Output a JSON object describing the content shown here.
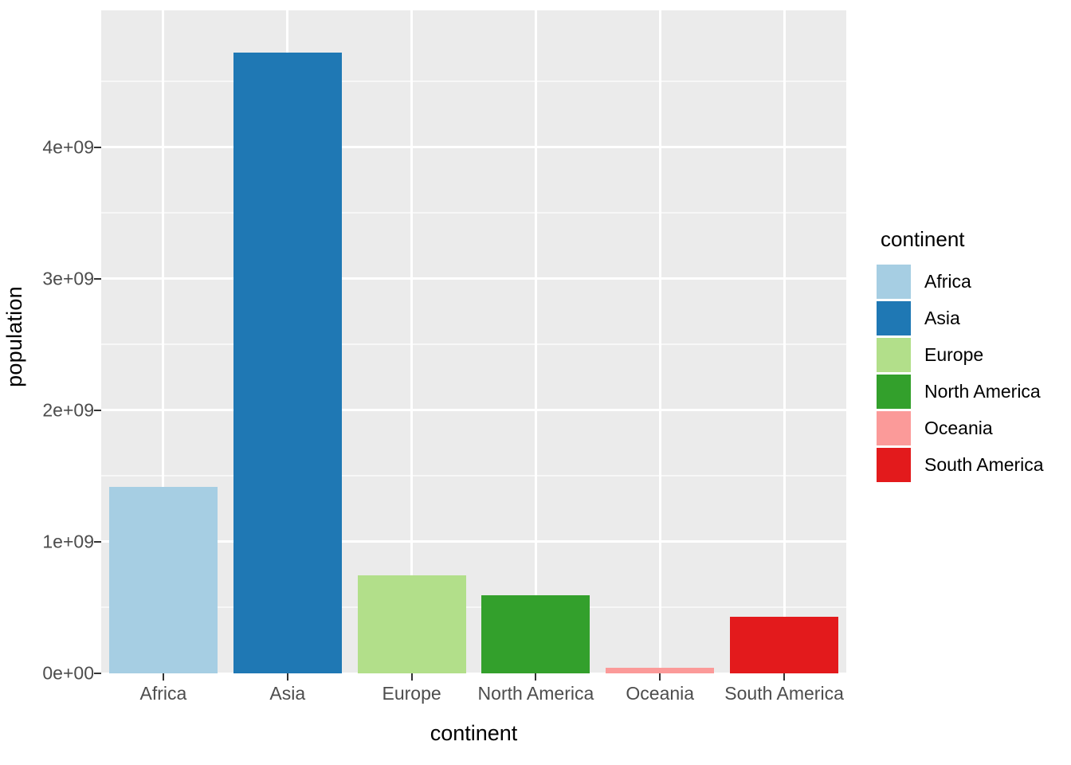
{
  "chart_data": {
    "type": "bar",
    "title": "",
    "xlabel": "continent",
    "ylabel": "population",
    "categories": [
      "Africa",
      "Asia",
      "Europe",
      "North America",
      "Oceania",
      "South America"
    ],
    "values": [
      1420000000,
      4720000000,
      745000000,
      595000000,
      45000000,
      430000000
    ],
    "series": [
      {
        "name": "population",
        "values": [
          1420000000,
          4720000000,
          745000000,
          595000000,
          45000000,
          430000000
        ]
      }
    ],
    "ylim": [
      0,
      5040000000
    ],
    "ytick_values": [
      0,
      1000000000,
      2000000000,
      3000000000,
      4000000000
    ],
    "ytick_labels": [
      "0e+00",
      "1e+09",
      "2e+09",
      "3e+09",
      "4e+09"
    ],
    "yminor_values": [
      500000000,
      1500000000,
      2500000000,
      3500000000,
      4500000000
    ],
    "grid": true,
    "legend_position": "right",
    "legend_title": "continent",
    "bar_colors": [
      "#a6cee3",
      "#1f78b4",
      "#b2df8a",
      "#33a02c",
      "#fb9a99",
      "#e31a1c"
    ],
    "panel_background": "#ebebeb",
    "grid_color": "#ffffff",
    "legend_entries": [
      {
        "label": "Africa",
        "color": "#a6cee3"
      },
      {
        "label": "Asia",
        "color": "#1f78b4"
      },
      {
        "label": "Europe",
        "color": "#b2df8a"
      },
      {
        "label": "North America",
        "color": "#33a02c"
      },
      {
        "label": "Oceania",
        "color": "#fb9a99"
      },
      {
        "label": "South America",
        "color": "#e31a1c"
      }
    ]
  }
}
